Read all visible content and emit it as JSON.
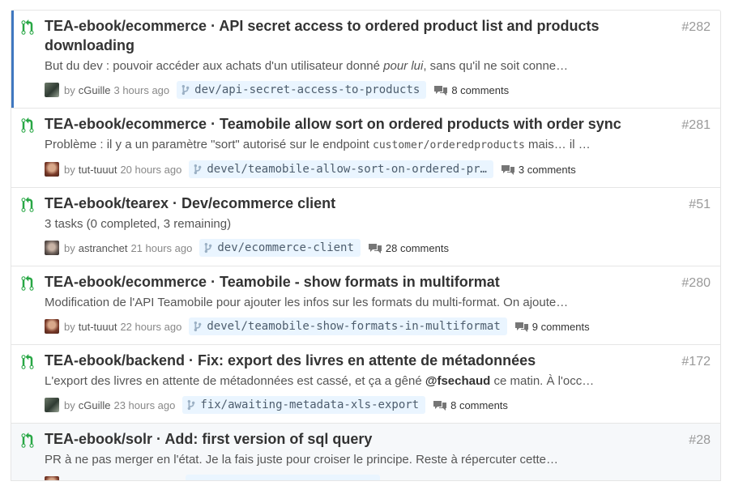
{
  "colors": {
    "pr_open": "#28a745",
    "selected_bar": "#4078c0",
    "branch_bg": "#eaf5ff"
  },
  "items": [
    {
      "title": "TEA-ebook/ecommerce · API secret access to ordered product list and products downloading",
      "number": "#282",
      "desc_before": "But du dev : pouvoir accéder aux achats d'un utilisateur donné ",
      "desc_em": "pour lui",
      "desc_after": ", sans qu'il ne soit conne…",
      "by": "by",
      "author": "cGuille",
      "time": "3 hours ago",
      "branch": "dev/api-secret-access-to-products",
      "comments": "8 comments"
    },
    {
      "title": "TEA-ebook/ecommerce · Teamobile allow sort on ordered products with order sync",
      "number": "#281",
      "desc_before": "Problème : il y a un paramètre \"sort\" autorisé sur le endpoint ",
      "desc_code": "customer/orderedproducts",
      "desc_after": " mais… il …",
      "by": "by",
      "author": "tut-tuuut",
      "time": "20 hours ago",
      "branch": "devel/teamobile-allow-sort-on-ordered-pr…",
      "comments": "3 comments"
    },
    {
      "title": "TEA-ebook/tearex · Dev/ecommerce client",
      "number": "#51",
      "desc": "3 tasks (0 completed, 3 remaining)",
      "by": "by",
      "author": "astranchet",
      "time": "21 hours ago",
      "branch": "dev/ecommerce-client",
      "comments": "28 comments"
    },
    {
      "title": "TEA-ebook/ecommerce · Teamobile - show formats in multiformat",
      "number": "#280",
      "desc": "Modification de l'API Teamobile pour ajouter les infos sur les formats du multi-format. On ajoute…",
      "by": "by",
      "author": "tut-tuuut",
      "time": "22 hours ago",
      "branch": "devel/teamobile-show-formats-in-multiformat",
      "comments": "9 comments"
    },
    {
      "title": "TEA-ebook/backend · Fix: export des livres en attente de métadonnées",
      "number": "#172",
      "desc_before": "L'export des livres en attente de métadonnées est cassé, et ça a gêné ",
      "desc_strong": "@fsechaud",
      "desc_after": " ce matin. À l'occ…",
      "by": "by",
      "author": "cGuille",
      "time": "23 hours ago",
      "branch": "fix/awaiting-metadata-xls-export",
      "comments": "8 comments"
    },
    {
      "title": "TEA-ebook/solr · Add: first version of sql query",
      "number": "#28",
      "desc": "PR à ne pas merger en l'état. Je la fais juste pour croiser le principe. Reste à répercuter cette…"
    }
  ]
}
